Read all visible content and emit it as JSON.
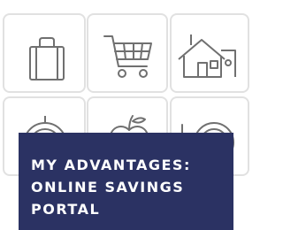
{
  "banner": {
    "title_lines": [
      "MY ADVANTAGES:",
      "ONLINE SAVINGS",
      "PORTAL"
    ]
  },
  "tiles": [
    {
      "icon": "briefcase-icon"
    },
    {
      "icon": "shopping-cart-icon"
    },
    {
      "icon": "house-icon"
    },
    {
      "icon": "steering-wheel-icon"
    },
    {
      "icon": "apple-icon"
    },
    {
      "icon": "plate-icon"
    }
  ],
  "colors": {
    "banner_bg": "#2b3263",
    "banner_text": "#ffffff",
    "tile_border": "#e1e1e1",
    "icon_stroke": "#707070"
  }
}
